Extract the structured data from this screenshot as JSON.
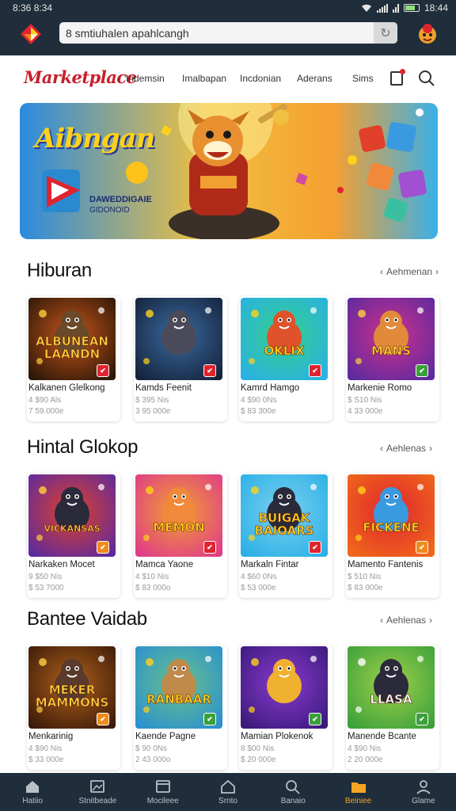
{
  "status_bar": {
    "time": "8:36 8:34",
    "battery": "18:44"
  },
  "search": {
    "value": "8 smtiuhalen apahlcangh"
  },
  "brand": "Marketplace",
  "nav": [
    "Indemsin",
    "Imalbapan",
    "Incdonian",
    "Aderans",
    "Sims"
  ],
  "banner": {
    "title": "Aibngan",
    "sub1": "DAWEDDIGAIE",
    "sub2": "GIDONOID"
  },
  "sections": [
    {
      "title": "Hiburan",
      "more": "Aehmenan",
      "items": [
        {
          "title": "Kalkanen Glelkong",
          "sub1": "4 $90 Als",
          "sub2": "7 59.000e",
          "art": "ALBUNEAN\nLAANDN",
          "bg": [
            "#2a1608",
            "#c8561a"
          ],
          "fg": "#ffcf3a",
          "char": "#6a4a2a",
          "badge": "#e0242f"
        },
        {
          "title": "Kamds Feenit",
          "sub1": "$ 395 Nis",
          "sub2": "3 95 000e",
          "art": "",
          "bg": [
            "#14223a",
            "#3a6aa0"
          ],
          "fg": "#ffd21a",
          "char": "#4a4a5a",
          "badge": "#e0242f"
        },
        {
          "title": "Kamrd Hamgo",
          "sub1": "4 $90 0Ns",
          "sub2": "$ 83 300e",
          "art": "OKLIX",
          "bg": [
            "#2ab0e6",
            "#34d08a"
          ],
          "fg": "#ffd21a",
          "char": "#e0522a",
          "badge": "#e0242f"
        },
        {
          "title": "Markenie Romo",
          "sub1": "$ S10 Nis",
          "sub2": "4 33 000e",
          "art": "MANS",
          "bg": [
            "#5a2aa0",
            "#d0308a"
          ],
          "fg": "#ffcf3a",
          "char": "#e08a3a",
          "badge": "#3aa03a"
        }
      ]
    },
    {
      "title": "Hintal Glokop",
      "more": "Aehlenas",
      "items": [
        {
          "title": "Narkaken Mocet",
          "sub1": "9 $50 Nis",
          "sub2": "$ 53 7000",
          "art": "VICKANSAS",
          "bg": [
            "#5a2aa0",
            "#e0402a"
          ],
          "fg": "#ffcf3a",
          "char": "#2a2a3a",
          "badge": "#f08a1a"
        },
        {
          "title": "Mamca Yaone",
          "sub1": "4 $10 Nis",
          "sub2": "$ 83 000o",
          "art": "MEMON",
          "bg": [
            "#e03a8a",
            "#f0a030"
          ],
          "fg": "#ffd21a",
          "char": "#f08a3a",
          "badge": "#e0242f"
        },
        {
          "title": "Markaln Fintar",
          "sub1": "4 $60 0Ns",
          "sub2": "$ 53 000e",
          "art": "BUIGAK\nBAIOARS",
          "bg": [
            "#2ab0e6",
            "#7ad0f0"
          ],
          "fg": "#ffd21a",
          "char": "#2a2a3a",
          "badge": "#e0242f"
        },
        {
          "title": "Mamento Fantenis",
          "sub1": "$ 510 Nis",
          "sub2": "$ 83 000e",
          "art": "FICKENE",
          "bg": [
            "#f06a1a",
            "#e0242f"
          ],
          "fg": "#ffd21a",
          "char": "#3a9ae0",
          "badge": "#f08a1a"
        }
      ]
    },
    {
      "title": "Bantee Vaidab",
      "more": "Aehlenas",
      "items": [
        {
          "title": "Menkarinig",
          "sub1": "4 $90 Nis",
          "sub2": "$ 33 000e",
          "art": "MEKER\nMAMMONS",
          "bg": [
            "#3a1a0a",
            "#b0601a"
          ],
          "fg": "#ffcf3a",
          "char": "#5a3a2a",
          "badge": "#f08a1a"
        },
        {
          "title": "Kaende Pagne",
          "sub1": "$ 90 0Ns",
          "sub2": "2 43 000o",
          "art": "RANBAAR",
          "bg": [
            "#2a90d0",
            "#6ac08a"
          ],
          "fg": "#ffd21a",
          "char": "#c08a4a",
          "badge": "#3aa03a"
        },
        {
          "title": "Mamian Plokenok",
          "sub1": "8 $00 Nis",
          "sub2": "$ 20 000e",
          "art": "",
          "bg": [
            "#3a1a7a",
            "#8a3ad0"
          ],
          "fg": "#ffd21a",
          "char": "#f0b030",
          "badge": "#3aa03a"
        },
        {
          "title": "Manende Bcante",
          "sub1": "4 $90 Nis",
          "sub2": "2 20 000e",
          "art": "LLASA",
          "bg": [
            "#3aa03a",
            "#a0d04a"
          ],
          "fg": "#ffffff",
          "char": "#2a2a3a",
          "badge": "#3aa03a"
        }
      ]
    }
  ],
  "bottom_tabs": [
    {
      "label": "Hatiio",
      "icon": "home-icon"
    },
    {
      "label": "Stnitbeade",
      "icon": "image-icon"
    },
    {
      "label": "Mocileee",
      "icon": "window-icon"
    },
    {
      "label": "Srnto",
      "icon": "house-outline-icon"
    },
    {
      "label": "Banaio",
      "icon": "search-icon"
    },
    {
      "label": "Beiniee",
      "icon": "folder-icon",
      "active": true
    },
    {
      "label": "Glame",
      "icon": "user-icon"
    }
  ],
  "colors": {
    "chrome": "#1f2e3a",
    "accent": "#f5a524",
    "brand": "#c81e2c"
  }
}
